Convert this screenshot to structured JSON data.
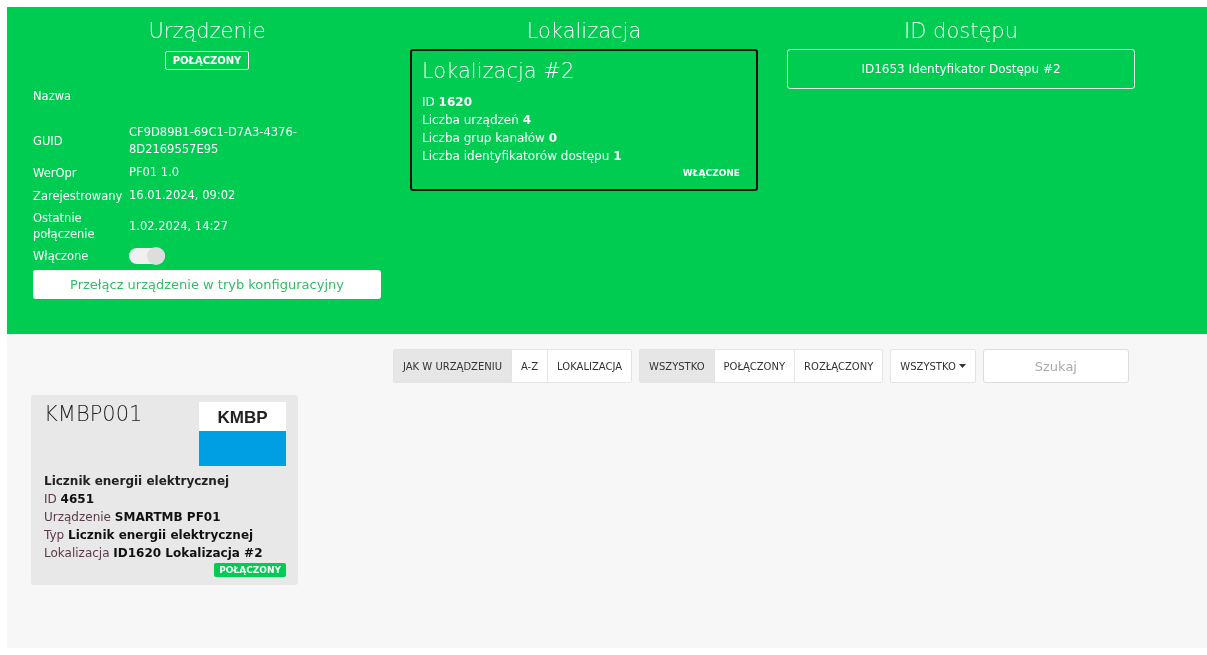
{
  "device": {
    "heading": "Urządzenie",
    "status_badge": "POŁĄCZONY",
    "fields": [
      {
        "label": "Nazwa"
      },
      {
        "label": "GUID",
        "value": "CF9D89B1-69C1-D7A3-4376-8D2169557E95"
      },
      {
        "label": "WerOpr",
        "value": "PF01 1.0"
      },
      {
        "label": "Zarejestrowany",
        "value": "16.01.2024, 09:02"
      },
      {
        "label": "Ostatnie połączenie",
        "value": "1.02.2024, 14:27"
      }
    ],
    "enabled": {
      "label": "Włączone",
      "on": true
    },
    "config_button": "Przełącz urządzenie w tryb konfiguracyjny"
  },
  "location": {
    "heading": "Lokalizacja",
    "title": "Lokalizacja #2",
    "lines": [
      {
        "label": "ID",
        "value": "1620"
      },
      {
        "label": "Liczba urządzeń",
        "value": "4"
      },
      {
        "label": "Liczba grup kanałów",
        "value": "0"
      },
      {
        "label": "Liczba identyfikatorów dostępu",
        "value": "1"
      }
    ],
    "badge": "WŁĄCZONE"
  },
  "access": {
    "heading": "ID dostępu",
    "button": "ID1653 Identyfikator Dostępu #2"
  },
  "toolbar": {
    "sort": [
      {
        "label": "JAK W URZĄDZENIU",
        "selected": true
      },
      {
        "label": "A-Z",
        "selected": false
      },
      {
        "label": "LOKALIZACJA",
        "selected": false
      }
    ],
    "status": [
      {
        "label": "WSZYSTKO",
        "selected": true
      },
      {
        "label": "POŁĄCZONY",
        "selected": false
      },
      {
        "label": "ROZŁĄCZONY",
        "selected": false
      }
    ],
    "dropdown": "WSZYSTKO",
    "search": {
      "placeholder": "Szukaj"
    }
  },
  "channels": [
    {
      "caption": "KMBP001",
      "logo": "KMBP",
      "name": "Licznik energii elektrycznej",
      "lines": [
        {
          "label": "ID",
          "value": "4651"
        },
        {
          "label": "Urządzenie",
          "value": "SMARTMB PF01"
        },
        {
          "label": "Typ",
          "value": "Licznik energii elektrycznej"
        },
        {
          "label": "Lokalizacja",
          "value": "ID1620 Lokalizacja #2"
        }
      ],
      "status_badge": "POŁĄCZONY"
    }
  ]
}
